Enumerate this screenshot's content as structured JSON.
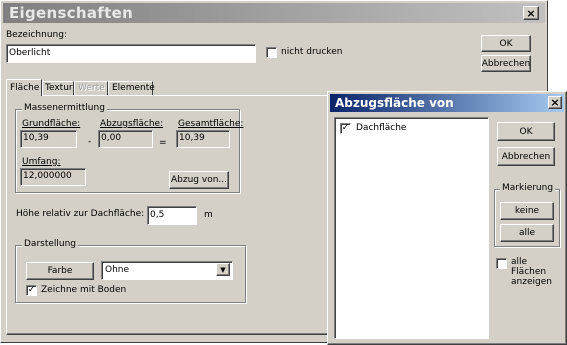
{
  "main_window": {
    "title": "Eigenschaften",
    "close_glyph": "×",
    "name_label": "Bezeichnung:",
    "name_value": "Oberlicht",
    "no_print_label": "nicht drucken",
    "ok_label": "OK",
    "cancel_label": "Abbrechen",
    "tabs": [
      {
        "label": "Fläche",
        "active": true,
        "disabled": false
      },
      {
        "label": "Textur",
        "active": false,
        "disabled": false
      },
      {
        "label": "Werte",
        "active": false,
        "disabled": true
      },
      {
        "label": "Elemente",
        "active": false,
        "disabled": false
      }
    ],
    "mass_group": {
      "title": "Massenermittlung",
      "gross_label": "Grundfläche:",
      "gross_value": "10,39",
      "minus": "-",
      "deduct_label": "Abzugsfläche:",
      "deduct_value": "0,00",
      "equals": "=",
      "total_label": "Gesamtfläche:",
      "total_value": "10,39",
      "perimeter_label": "Umfang:",
      "perimeter_value": "12,000000",
      "deduct_from_button": "Abzug von..."
    },
    "height_label": "Höhe relativ zur Dachfläche:",
    "height_value": "0,5",
    "height_unit": "m",
    "display_group": {
      "title": "Darstellung",
      "color_button": "Farbe",
      "color_select_value": "Ohne",
      "draw_floor_label": "Zeichne mit Boden",
      "draw_floor_checked": true
    }
  },
  "dialog": {
    "title": "Abzugsfläche von",
    "close_glyph": "×",
    "list_items": [
      {
        "label": "Dachfläche",
        "checked": true
      }
    ],
    "ok_label": "OK",
    "cancel_label": "Abbrechen",
    "mark_group": {
      "title": "Markierung",
      "none_label": "keine",
      "all_label": "alle"
    },
    "show_all_label": "alle Flächen anzeigen",
    "show_all_checked": false
  },
  "colors": {
    "face": "#d4d0c8",
    "main_title_bg": "#c0c0c0",
    "dialog_title_gradient": [
      "#0a246a",
      "#a6caf0"
    ]
  }
}
